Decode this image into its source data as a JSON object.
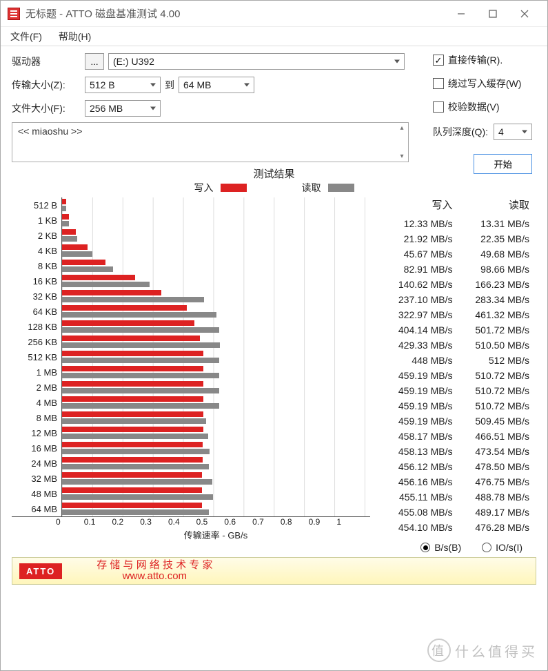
{
  "window": {
    "title": "无标题 - ATTO 磁盘基准测试 4.00"
  },
  "menu": {
    "file": "文件(F)",
    "help": "帮助(H)"
  },
  "labels": {
    "drive": "驱动器",
    "transfer": "传输大小(Z):",
    "to": "到",
    "filesize": "文件大小(F):",
    "direct": "直接传输(R).",
    "bypass": "绕过写入缓存(W)",
    "verify": "校验数据(V)",
    "queue": "队列深度(Q):",
    "start": "开始",
    "desc": "<< miaoshu >>",
    "results_title": "测试结果",
    "legend_write": "写入",
    "legend_read": "读取",
    "xaxis": "传输速率 - GB/s",
    "col_write": "写入",
    "col_read": "读取",
    "unit_bs": "B/s(B)",
    "unit_ios": "IO/s(I)",
    "footer_brand": "ATTO",
    "footer_line1": "存 储 与 网 络 技 术 专 家",
    "footer_line2": "www.atto.com",
    "watermark": "什么值得买",
    "watermark_icon": "值"
  },
  "selects": {
    "drive": "(E:) U392",
    "size_from": "512 B",
    "size_to": "64 MB",
    "filesize": "256 MB",
    "queue": "4"
  },
  "checks": {
    "direct": true,
    "bypass": false,
    "verify": false
  },
  "radio": {
    "bs": true,
    "ios": false
  },
  "chart_data": {
    "type": "bar",
    "title": "测试结果",
    "xlabel": "传输速率 - GB/s",
    "ylabel": "",
    "xlim": [
      0,
      1
    ],
    "xticks": [
      "0",
      "0.1",
      "0.2",
      "0.3",
      "0.4",
      "0.5",
      "0.6",
      "0.7",
      "0.8",
      "0.9",
      "1"
    ],
    "unit": "MB/s",
    "categories": [
      "512 B",
      "1 KB",
      "2 KB",
      "4 KB",
      "8 KB",
      "16 KB",
      "32 KB",
      "64 KB",
      "128 KB",
      "256 KB",
      "512 KB",
      "1 MB",
      "2 MB",
      "4 MB",
      "8 MB",
      "12 MB",
      "16 MB",
      "24 MB",
      "32 MB",
      "48 MB",
      "64 MB"
    ],
    "series": [
      {
        "name": "写入",
        "color": "#d22",
        "values": [
          12.33,
          21.92,
          45.67,
          82.91,
          140.62,
          237.1,
          322.97,
          404.14,
          429.33,
          448,
          459.19,
          459.19,
          459.19,
          459.19,
          458.17,
          458.13,
          456.12,
          456.16,
          455.11,
          455.08,
          454.1
        ]
      },
      {
        "name": "读取",
        "color": "#888",
        "values": [
          13.31,
          22.35,
          49.68,
          98.66,
          166.23,
          283.34,
          461.32,
          501.72,
          510.5,
          512,
          510.72,
          510.72,
          510.72,
          509.45,
          466.51,
          473.54,
          478.5,
          476.75,
          488.78,
          489.17,
          476.28
        ]
      }
    ]
  },
  "table": {
    "unit": "MB/s",
    "rows": [
      {
        "w": "12.33",
        "r": "13.31"
      },
      {
        "w": "21.92",
        "r": "22.35"
      },
      {
        "w": "45.67",
        "r": "49.68"
      },
      {
        "w": "82.91",
        "r": "98.66"
      },
      {
        "w": "140.62",
        "r": "166.23"
      },
      {
        "w": "237.10",
        "r": "283.34"
      },
      {
        "w": "322.97",
        "r": "461.32"
      },
      {
        "w": "404.14",
        "r": "501.72"
      },
      {
        "w": "429.33",
        "r": "510.50"
      },
      {
        "w": "448",
        "r": "512"
      },
      {
        "w": "459.19",
        "r": "510.72"
      },
      {
        "w": "459.19",
        "r": "510.72"
      },
      {
        "w": "459.19",
        "r": "510.72"
      },
      {
        "w": "459.19",
        "r": "509.45"
      },
      {
        "w": "458.17",
        "r": "466.51"
      },
      {
        "w": "458.13",
        "r": "473.54"
      },
      {
        "w": "456.12",
        "r": "478.50"
      },
      {
        "w": "456.16",
        "r": "476.75"
      },
      {
        "w": "455.11",
        "r": "488.78"
      },
      {
        "w": "455.08",
        "r": "489.17"
      },
      {
        "w": "454.10",
        "r": "476.28"
      }
    ]
  }
}
